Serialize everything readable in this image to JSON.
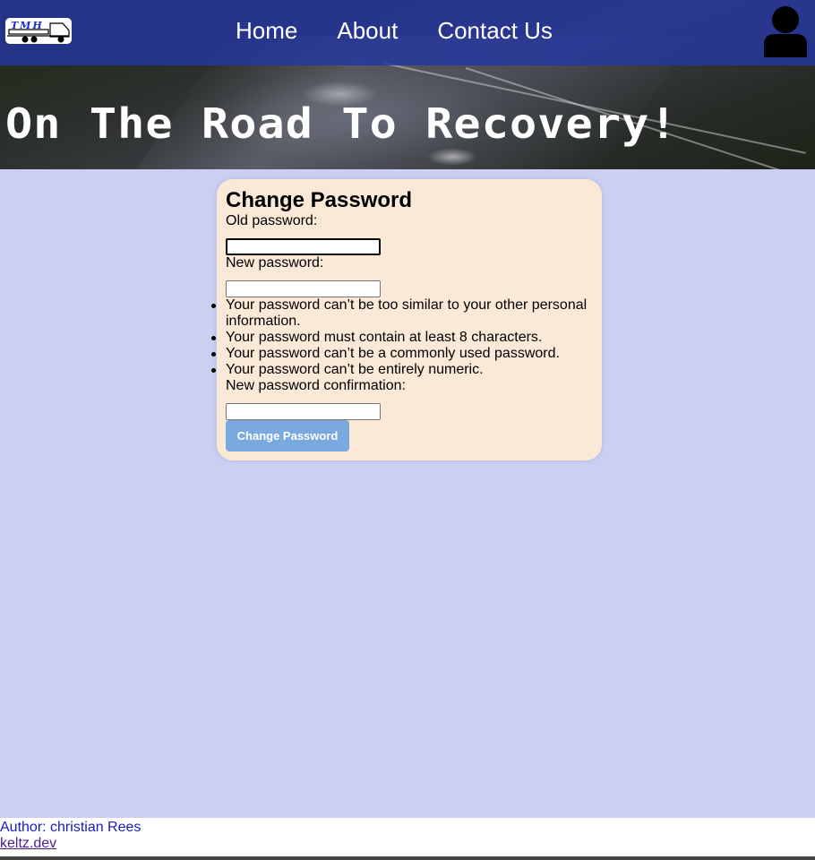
{
  "header": {
    "logo_text": "TMH",
    "nav": [
      {
        "label": "Home"
      },
      {
        "label": "About"
      },
      {
        "label": "Contact Us"
      }
    ],
    "hero_title": "On The Road To Recovery!"
  },
  "form": {
    "title": "Change Password",
    "old_password_label": "Old password:",
    "new_password_label": "New password:",
    "confirm_label": "New password confirmation:",
    "old_password_value": "",
    "new_password_value": "",
    "confirm_value": "",
    "help_items": [
      "Your password can’t be too similar to your other personal information.",
      "Your password must contain at least 8 characters.",
      "Your password can’t be a commonly used password.",
      "Your password can’t be entirely numeric."
    ],
    "submit_label": "Change Password"
  },
  "footer": {
    "author": "Author: christian Rees",
    "link": "keltz.dev"
  },
  "colors": {
    "page_bg": "#cbcff2",
    "navbar": "#2636a0",
    "card_bg": "#fae9d7",
    "button": "#7aa9e0"
  }
}
